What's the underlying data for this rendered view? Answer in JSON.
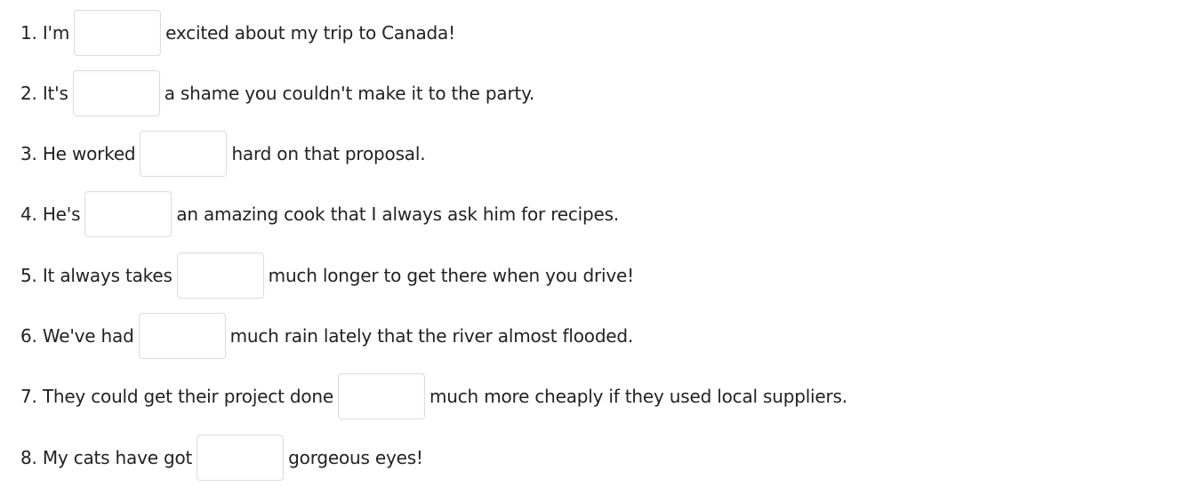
{
  "questions": [
    {
      "before": "1. I'm",
      "value": "",
      "after": "excited about my trip to Canada!"
    },
    {
      "before": "2. It's",
      "value": "",
      "after": "a shame you couldn't make it to the party."
    },
    {
      "before": "3. He worked",
      "value": "",
      "after": "hard on that proposal."
    },
    {
      "before": "4. He's",
      "value": "",
      "after": "an amazing cook that I always ask him for recipes."
    },
    {
      "before": "5. It always takes",
      "value": "",
      "after": "much longer to get there when you drive!"
    },
    {
      "before": "6. We've had",
      "value": "",
      "after": "much rain lately that the river almost flooded."
    },
    {
      "before": "7. They could get their project done",
      "value": "",
      "after": "much more cheaply if they used local suppliers."
    },
    {
      "before": "8. My cats have got",
      "value": "",
      "after": "gorgeous eyes!"
    }
  ]
}
